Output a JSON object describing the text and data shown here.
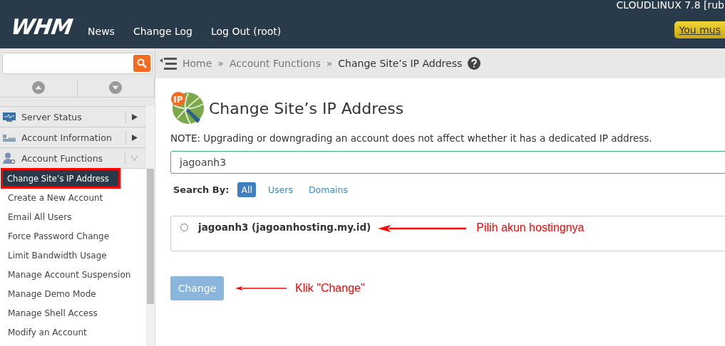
{
  "header": {
    "logo": "WHM",
    "nav": [
      {
        "label": "News"
      },
      {
        "label": "Change Log"
      },
      {
        "label": "Log Out (root)"
      }
    ],
    "server_info": "CLOUDLINUX 7.8 [rub",
    "notice": "You mus"
  },
  "breadcrumb": {
    "items": [
      "Home",
      "Account Functions",
      "Change Site’s IP Address"
    ],
    "separator": "»"
  },
  "sidebar": {
    "menu": [
      {
        "label": "Server Status",
        "kind": "monitor",
        "expanded": false
      },
      {
        "label": "Account Information",
        "kind": "list",
        "expanded": false
      },
      {
        "label": "Account Functions",
        "kind": "user",
        "expanded": true,
        "children": [
          {
            "label": "Change Site’s IP Address",
            "selected": true,
            "highlighted": true
          },
          {
            "label": "Create a New Account",
            "selected": false,
            "highlighted": false
          },
          {
            "label": "Email All Users",
            "selected": false,
            "highlighted": false
          },
          {
            "label": "Force Password Change",
            "selected": false,
            "highlighted": false
          },
          {
            "label": "Limit Bandwidth Usage",
            "selected": false,
            "highlighted": false
          },
          {
            "label": "Manage Account Suspension",
            "selected": false,
            "highlighted": false
          },
          {
            "label": "Manage Demo Mode",
            "selected": false,
            "highlighted": false
          },
          {
            "label": "Manage Shell Access",
            "selected": false,
            "highlighted": false
          },
          {
            "label": "Modify an Account",
            "selected": false,
            "highlighted": false
          }
        ]
      }
    ]
  },
  "page": {
    "title": "Change Site’s IP Address",
    "icon_badge": "IP",
    "note": "NOTE: Upgrading or downgrading an account does not affect whether it has a dedicated IP address.",
    "search_value": "jagoanh3",
    "search_by_label": "Search By:",
    "filters": [
      {
        "label": "All",
        "selected": true
      },
      {
        "label": "Users",
        "selected": false
      },
      {
        "label": "Domains",
        "selected": false
      }
    ],
    "results": [
      {
        "label": "jagoanh3 (jagoanhosting.my.id)",
        "selected": false,
        "annotation": "Pilih akun hostingnya"
      }
    ],
    "button": {
      "label": "Change",
      "disabled": true,
      "annotation": "Klik \"Change\""
    }
  }
}
